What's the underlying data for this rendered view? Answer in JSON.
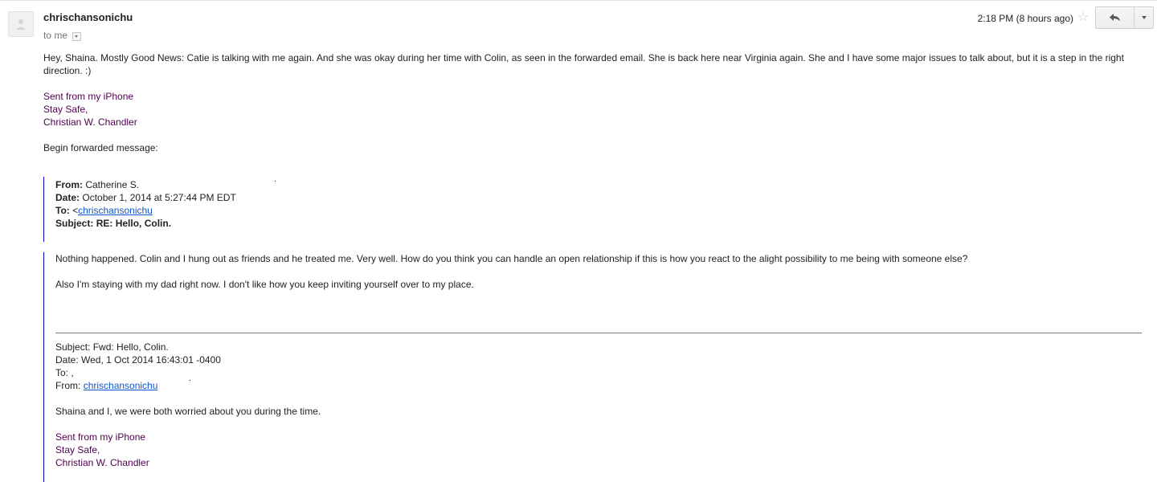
{
  "header": {
    "sender": "chrischansonichu",
    "to_label": "to me",
    "timestamp": "2:18 PM (8 hours ago)",
    "star_icon": "star-outline-icon",
    "reply_icon": "reply-arrow-icon",
    "more_icon": "chevron-down-icon"
  },
  "message": {
    "body_line": "Hey, Shaina.  Mostly Good News: Catie is talking with me again.  And she was okay during her time with Colin, as seen in the forwarded email.  She is back here near Virginia again.  She and I have some major issues to talk about, but it is a step in the right direction.  :)",
    "signature": {
      "line1": "Sent from my iPhone",
      "line2": "Stay Safe,",
      "line3": "Christian W. Chandler"
    },
    "forward_label": "Begin forwarded message:"
  },
  "forwarded_header": {
    "from_label": "From:",
    "from_value": "Catherine S.",
    "date_label": "Date:",
    "date_value": "October 1, 2014 at 5:27:44 PM EDT",
    "to_label": "To:",
    "to_prefix": "<",
    "to_link": "chrischansonichu",
    "subject_label": "Subject:",
    "subject_value": "RE: Hello, Colin."
  },
  "forwarded_body": {
    "para1": "Nothing happened. Colin and I hung out as friends and he treated me. Very well. How do you think you can handle an open relationship if this is how you react to the alight possibility to me being with someone else?",
    "para2": "Also I'm staying with my dad right now. I don't like how you keep inviting yourself over to my place."
  },
  "original_message": {
    "subject": "Subject: Fwd: Hello, Colin.",
    "date": "Date: Wed, 1 Oct 2014 16:43:01 -0400",
    "to": "To: ,",
    "from_label": "From:",
    "from_link": "chrischansonichu",
    "body": "Shaina and I, we were both worried about you during the time.",
    "signature": {
      "line1": "Sent from my iPhone",
      "line2": "Stay Safe,",
      "line3": "Christian W. Chandler"
    }
  }
}
